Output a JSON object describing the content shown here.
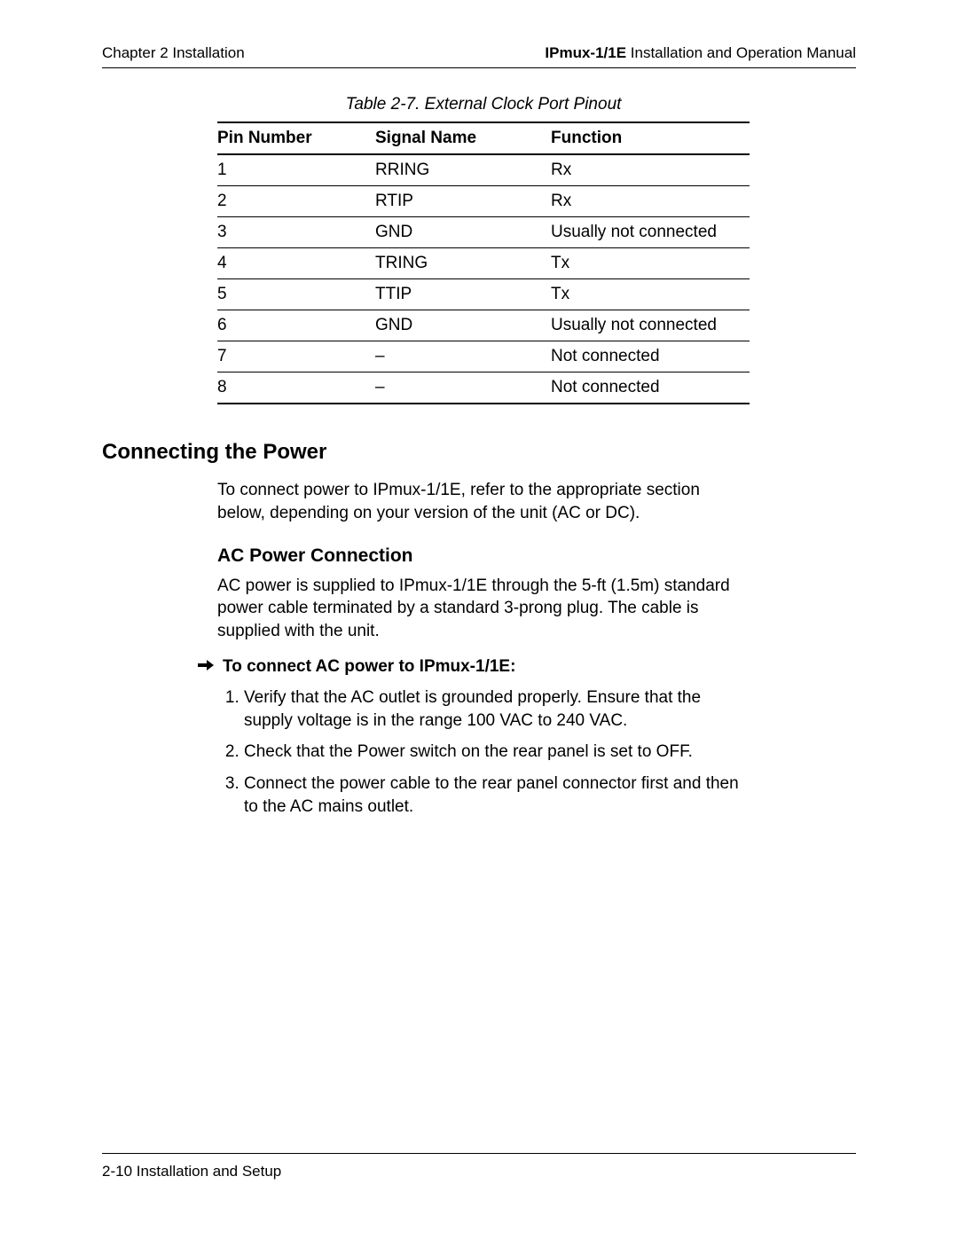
{
  "header": {
    "left": "Chapter 2  Installation",
    "right_bold": "IPmux-1/1E",
    "right_rest": " Installation and Operation Manual"
  },
  "table": {
    "caption": "Table 2-7.  External Clock Port Pinout",
    "columns": [
      "Pin Number",
      "Signal Name",
      "Function"
    ],
    "rows": [
      {
        "pin": "1",
        "signal": "RRING",
        "func": "Rx"
      },
      {
        "pin": "2",
        "signal": "RTIP",
        "func": "Rx"
      },
      {
        "pin": "3",
        "signal": "GND",
        "func": "Usually not connected"
      },
      {
        "pin": "4",
        "signal": "TRING",
        "func": "Tx"
      },
      {
        "pin": "5",
        "signal": "TTIP",
        "func": "Tx"
      },
      {
        "pin": "6",
        "signal": "GND",
        "func": "Usually not connected"
      },
      {
        "pin": "7",
        "signal": "–",
        "func": "Not connected"
      },
      {
        "pin": "8",
        "signal": "–",
        "func": "Not connected"
      }
    ]
  },
  "section": {
    "h2": "Connecting the Power",
    "intro": "To connect power to IPmux-1/1E, refer to the appropriate section below, depending on your version of the unit (AC or DC).",
    "h3": "AC Power Connection",
    "ac_para": "AC power is supplied to IPmux-1/1E through the 5-ft (1.5m) standard power cable terminated by a standard 3-prong plug. The cable is supplied with the unit.",
    "arrow_heading": "To connect AC power to IPmux-1/1E:",
    "steps": [
      "Verify that the AC outlet is grounded properly. Ensure that the supply voltage is in the range 100 VAC to 240 VAC.",
      "Check that the Power switch on the rear panel is set to OFF.",
      "Connect the power cable to the rear panel connector first and then to the AC mains outlet."
    ]
  },
  "footer": "2-10 Installation and Setup"
}
